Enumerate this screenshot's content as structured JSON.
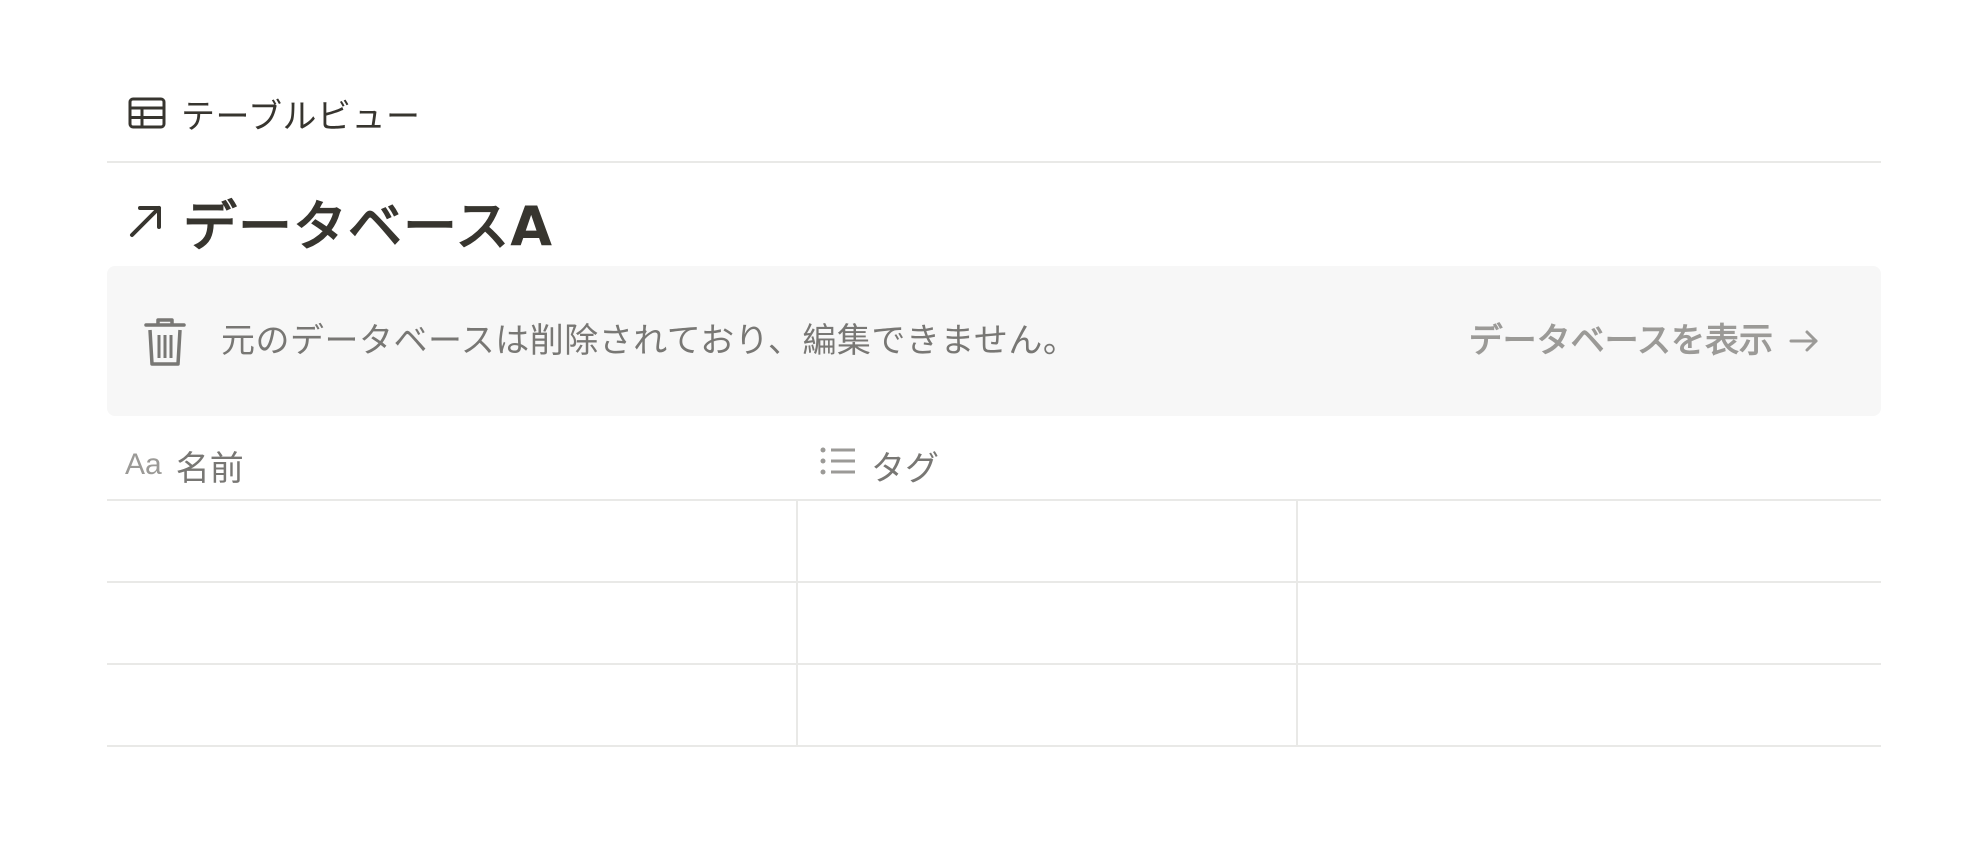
{
  "view_tab": {
    "label": "テーブルビュー",
    "icon": "table-icon"
  },
  "title": {
    "text": "データベースA",
    "icon": "arrow-up-right-icon"
  },
  "banner": {
    "icon": "trash-icon",
    "message": "元のデータベースは削除されており、編集できません。",
    "link_label": "データベースを表示",
    "link_icon": "arrow-right-icon"
  },
  "table": {
    "columns": [
      {
        "label": "名前",
        "icon_text": "Aa",
        "icon": "text-property-icon"
      },
      {
        "label": "タグ",
        "icon": "list-icon"
      }
    ],
    "rows": [
      {
        "name": "",
        "tag": "",
        "extra": ""
      },
      {
        "name": "",
        "tag": "",
        "extra": ""
      },
      {
        "name": "",
        "tag": "",
        "extra": ""
      }
    ]
  },
  "colors": {
    "text": "#37352f",
    "muted": "#787774",
    "banner_bg": "#f7f7f7",
    "divider": "#e9e9e7"
  }
}
